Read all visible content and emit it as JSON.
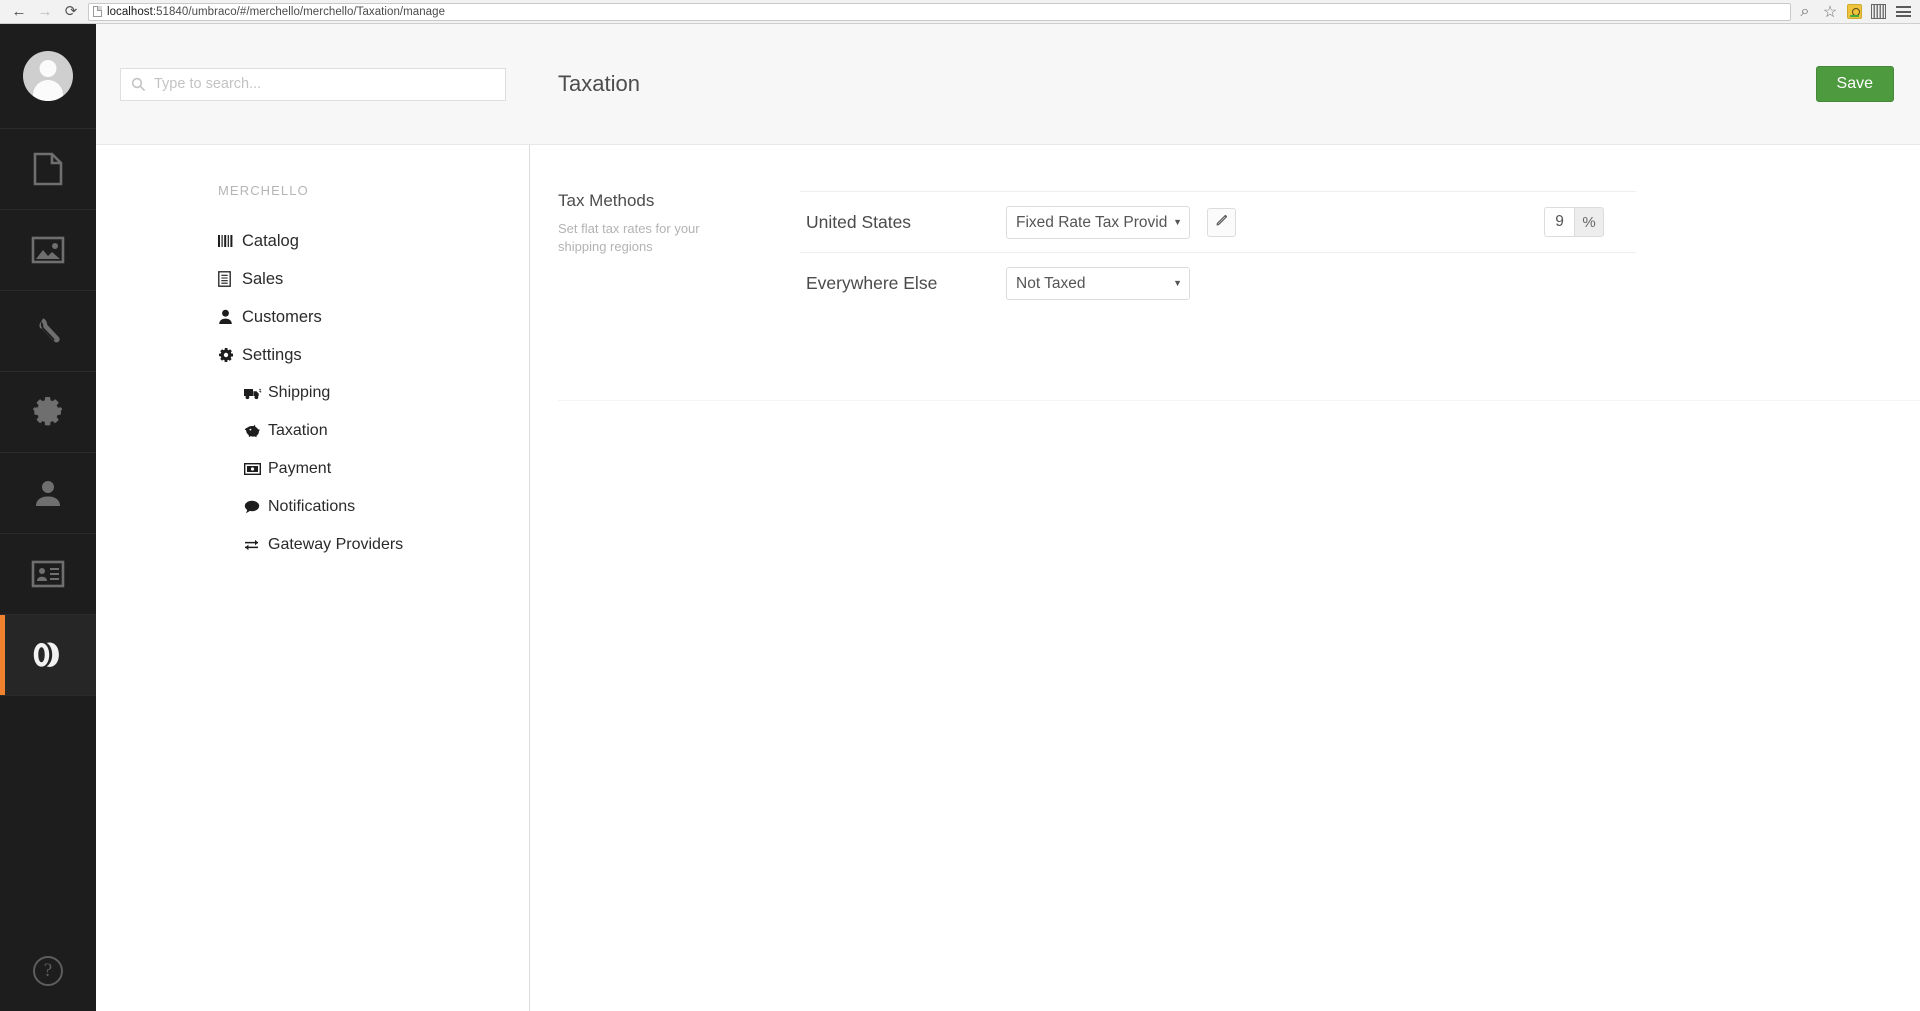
{
  "browser": {
    "url_host": "localhost",
    "url_rest": ":51840/umbraco/#/merchello/merchello/Taxation/manage",
    "back_glyph": "←",
    "forward_glyph": "→",
    "reload_glyph": "⟳",
    "zoom_glyph": "⌕",
    "bookmark_glyph": "☆",
    "icons": [
      "back-arrow-icon",
      "forward-arrow-icon",
      "reload-icon",
      "page-icon",
      "zoom-search-icon",
      "star-bookmark-icon",
      "extension-orange-icon",
      "extension-filmstrip-icon",
      "browser-menu-icon"
    ]
  },
  "app_nav": {
    "items": [
      {
        "name": "avatar",
        "label": "user-avatar"
      },
      {
        "name": "content",
        "label": "content-section"
      },
      {
        "name": "media",
        "label": "media-section"
      },
      {
        "name": "developer",
        "label": "developer-section"
      },
      {
        "name": "settings",
        "label": "settings-section"
      },
      {
        "name": "users",
        "label": "users-section"
      },
      {
        "name": "members",
        "label": "members-section"
      },
      {
        "name": "merchello",
        "label": "merchello-section",
        "active": true
      }
    ],
    "help_label": "?",
    "active_accent": "#f0812e",
    "background": "#1d1d1d"
  },
  "search": {
    "placeholder": "Type to search...",
    "value": ""
  },
  "tree": {
    "heading": "MERCHELLO",
    "items": [
      {
        "label": "Catalog",
        "icon": "barcode-icon",
        "level": 0
      },
      {
        "label": "Sales",
        "icon": "invoice-icon",
        "level": 0
      },
      {
        "label": "Customers",
        "icon": "customer-icon",
        "level": 0
      },
      {
        "label": "Settings",
        "icon": "gear-icon",
        "level": 0
      },
      {
        "label": "Shipping",
        "icon": "truck-icon",
        "level": 1
      },
      {
        "label": "Taxation",
        "icon": "piggy-bank-icon",
        "level": 1
      },
      {
        "label": "Payment",
        "icon": "money-bill-icon",
        "level": 1
      },
      {
        "label": "Notifications",
        "icon": "speech-bubble-icon",
        "level": 1
      },
      {
        "label": "Gateway Providers",
        "icon": "exchange-arrows-icon",
        "level": 1
      }
    ]
  },
  "editor": {
    "title": "Taxation",
    "save_label": "Save",
    "save_color": "#4e9a3f",
    "group": {
      "title": "Tax Methods",
      "description": "Set flat tax rates for your shipping regions"
    },
    "rows": [
      {
        "label": "United States",
        "provider_value": "Fixed Rate Tax Provider",
        "provider_options": [
          "Not Taxed",
          "Fixed Rate Tax Provider"
        ],
        "edit_icon": "pencil-icon",
        "rate_value": "9",
        "rate_unit": "%"
      },
      {
        "label": "Everywhere Else",
        "provider_value": "Not Taxed",
        "provider_options": [
          "Not Taxed",
          "Fixed Rate Tax Provider"
        ]
      }
    ]
  }
}
